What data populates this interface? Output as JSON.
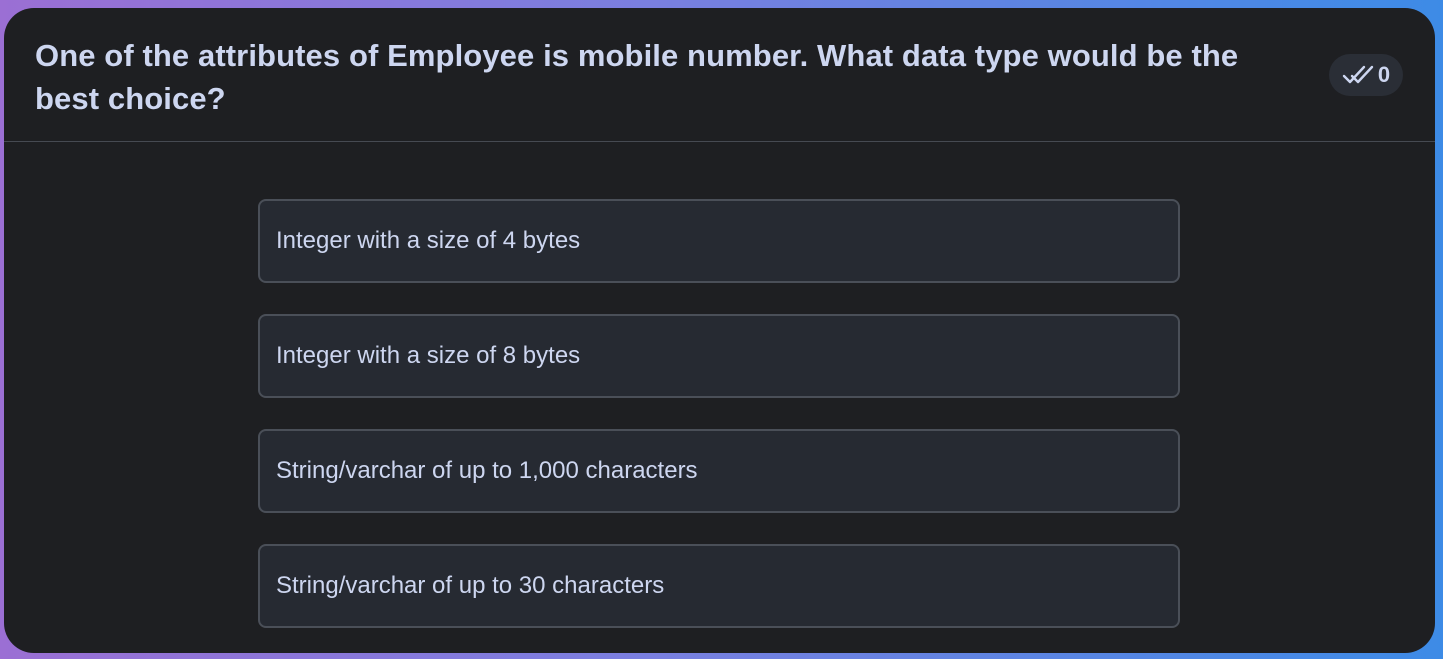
{
  "question": {
    "text": "One of the attributes of Employee is mobile number. What data type would be the best choice?"
  },
  "votes": {
    "icon": "double-check-icon",
    "count": "0"
  },
  "options": [
    {
      "label": "Integer with a size of 4 bytes"
    },
    {
      "label": "Integer with a size of 8 bytes"
    },
    {
      "label": "String/varchar of up to 1,000 characters"
    },
    {
      "label": "String/varchar of up to 30 characters"
    }
  ],
  "colors": {
    "card_background": "#1e1f22",
    "option_background": "#262a32",
    "option_border": "#4a4f58",
    "text": "#cdd6f0",
    "gradient_left": "#9b6fd4",
    "gradient_right": "#3d8be6"
  }
}
